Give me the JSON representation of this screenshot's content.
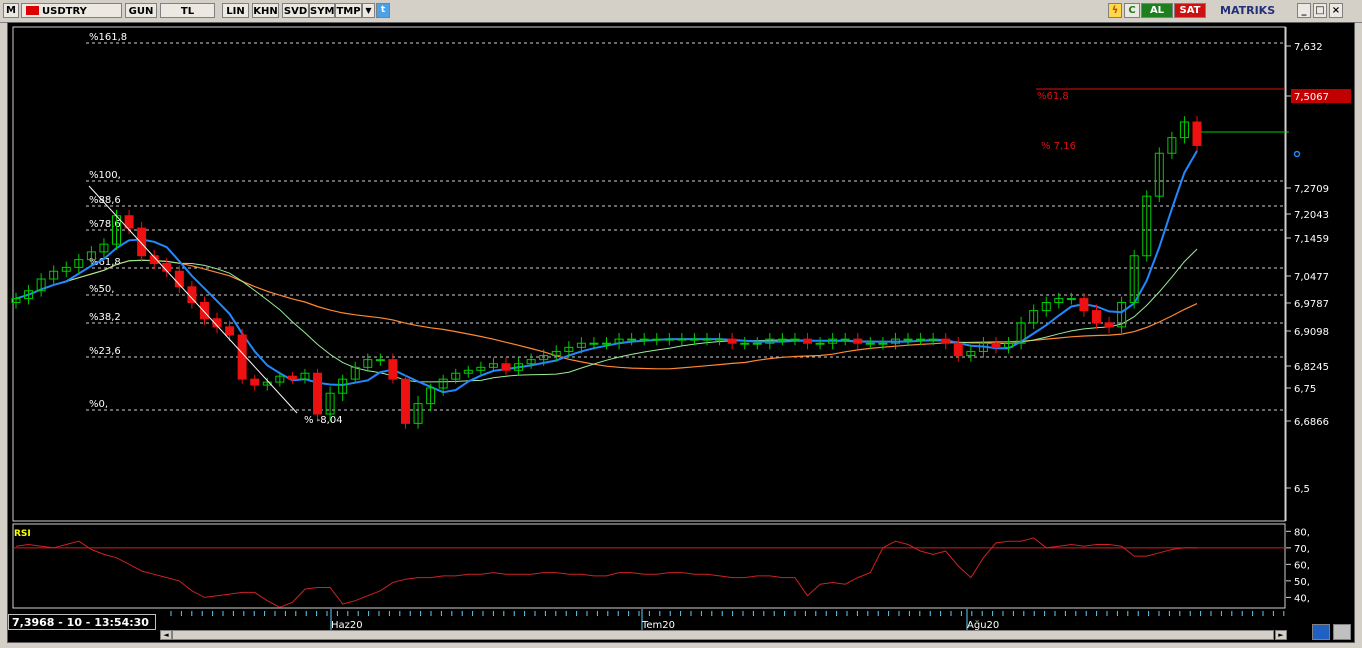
{
  "toolbar": {
    "m_label": "M",
    "symbol": "USDTRY",
    "buttons": [
      "GUN",
      "TL",
      "LIN",
      "KHN",
      "SVD",
      "SYM",
      "TMP"
    ],
    "al_label": "AL",
    "sat_label": "SAT",
    "c_label": "C",
    "brand": "MATRIKS",
    "colors": {
      "al": "#1e7f1e",
      "sat": "#cc1111"
    }
  },
  "price_scale": [
    "7,632",
    "7,5067",
    "7,2709",
    "7,2043",
    "7,1459",
    "7,0477",
    "6,9787",
    "6,9098",
    "6,8245",
    "6,75",
    "6,6866",
    "6,5"
  ],
  "fib_labels": [
    "%161,8",
    "%100,",
    "%88,6",
    "%78,6",
    "%61,8",
    "%50,",
    "%38,2",
    "%23,6",
    "%0,"
  ],
  "annotations": {
    "low_pct": "% -8,04",
    "high_pct": "% 7,16",
    "fib_618_red": "%61,8"
  },
  "rsi": {
    "label": "RSI",
    "scale": [
      "80,",
      "70,",
      "60,",
      "50,",
      "40,"
    ],
    "level": 70
  },
  "time_axis": [
    "Haz20",
    "Tem20",
    "Ağu20"
  ],
  "status_text": "7,3968 - 10 - 13:54:30",
  "colors": {
    "up": "#00cc00",
    "down": "#ee1111",
    "ma_fast": "#2288ff",
    "ma_mid": "#99ee99",
    "ma_slow": "#ff8833",
    "rsi_line": "#cc2222",
    "fib_line": "#d0d0d0"
  },
  "chart_data": {
    "type": "candlestick",
    "series": [
      {
        "name": "RSI",
        "values": [
          71,
          72,
          71,
          70,
          72,
          74,
          69,
          66,
          64,
          60,
          56,
          54,
          52,
          50,
          44,
          40,
          41,
          42,
          43,
          43,
          38,
          34,
          37,
          45,
          46,
          46,
          36,
          38,
          41,
          44,
          49,
          51,
          52,
          52,
          53,
          53,
          54,
          54,
          55,
          54,
          54,
          54,
          55,
          55,
          54,
          54,
          53,
          53,
          55,
          55,
          54,
          54,
          55,
          55,
          54,
          54,
          53,
          52,
          52,
          53,
          53,
          52,
          52,
          41,
          48,
          49,
          48,
          52,
          55,
          70,
          74,
          72,
          68,
          66,
          68,
          59,
          52,
          64,
          73,
          74,
          74,
          76,
          70,
          71,
          72,
          71,
          72,
          72,
          71,
          65,
          65,
          67,
          69,
          70,
          70
        ]
      }
    ]
  }
}
